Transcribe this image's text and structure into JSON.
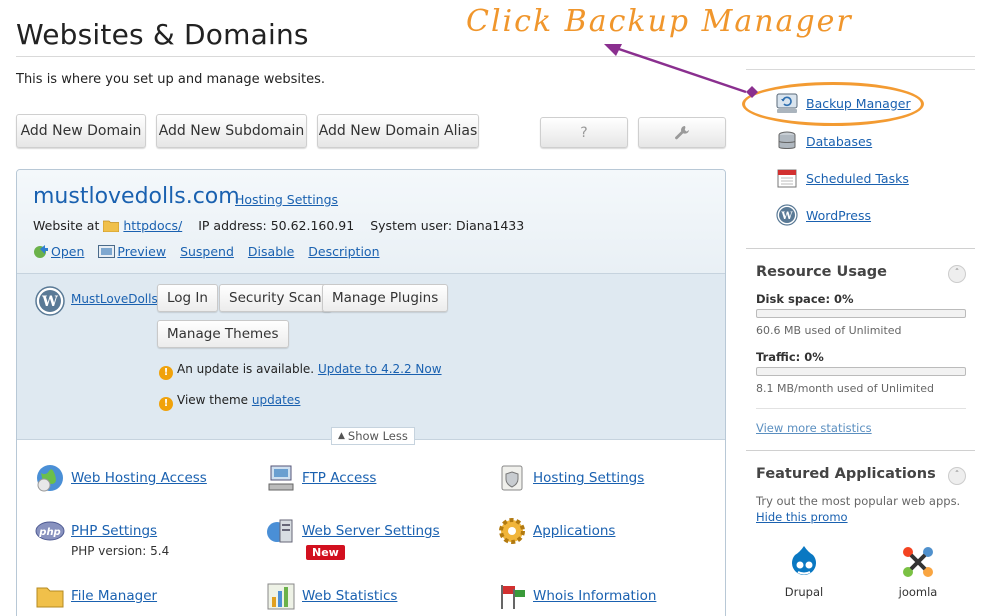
{
  "header": {
    "title": "Websites & Domains",
    "subtitle": "This is where you set up and manage websites."
  },
  "toolbar": {
    "add_domain": "Add New Domain",
    "add_subdomain": "Add New Subdomain",
    "add_alias": "Add New Domain Alias",
    "help_label": "?"
  },
  "domain": {
    "name": "mustlovedolls.com",
    "hosting_settings": "Hosting Settings",
    "website_at": "Website at",
    "docroot": "httpdocs/",
    "ip_label": "IP address: 50.62.160.91",
    "system_user": "System user: Diana1433",
    "actions": [
      "Open",
      "Preview",
      "Suspend",
      "Disable",
      "Description"
    ]
  },
  "wordpress": {
    "site": "MustLoveDolls",
    "buttons": [
      "Log In",
      "Security Scan",
      "Manage Plugins",
      "Manage Themes"
    ],
    "update_text": "An update is available.",
    "update_link": "Update to 4.2.2 Now",
    "theme_text": "View theme",
    "theme_link": "updates"
  },
  "show_less": "Show Less",
  "tools": [
    {
      "label": "Web Hosting Access",
      "icon": "globe-icon"
    },
    {
      "label": "FTP Access",
      "icon": "ftp-icon"
    },
    {
      "label": "Hosting Settings",
      "icon": "scroll-shield-icon"
    },
    {
      "label": "PHP Settings",
      "icon": "php-icon",
      "sub": "PHP version: 5.4"
    },
    {
      "label": "Web Server Settings",
      "icon": "server-icon",
      "badge": "New"
    },
    {
      "label": "Applications",
      "icon": "gear-icon"
    },
    {
      "label": "File Manager",
      "icon": "folder-icon"
    },
    {
      "label": "Web Statistics",
      "icon": "chart-icon"
    },
    {
      "label": "Whois Information",
      "icon": "flags-icon"
    }
  ],
  "sidebar": {
    "links": [
      "Backup Manager",
      "Databases",
      "Scheduled Tasks",
      "WordPress"
    ],
    "resource": {
      "title": "Resource Usage",
      "disk_label": "Disk space: 0%",
      "disk_pct": 0,
      "disk_note": "60.6 MB used of Unlimited",
      "traffic_label": "Traffic: 0%",
      "traffic_pct": 0,
      "traffic_note": "8.1 MB/month used of Unlimited",
      "more": "View more statistics"
    },
    "featured": {
      "title": "Featured Applications",
      "desc": "Try out the most popular web apps.",
      "hide": "Hide this promo",
      "apps": [
        "Drupal",
        "joomla"
      ]
    }
  },
  "annotation": {
    "text": "Click Backup Manager",
    "color": "#f0962c",
    "arrow_color": "#8a2f8f"
  }
}
